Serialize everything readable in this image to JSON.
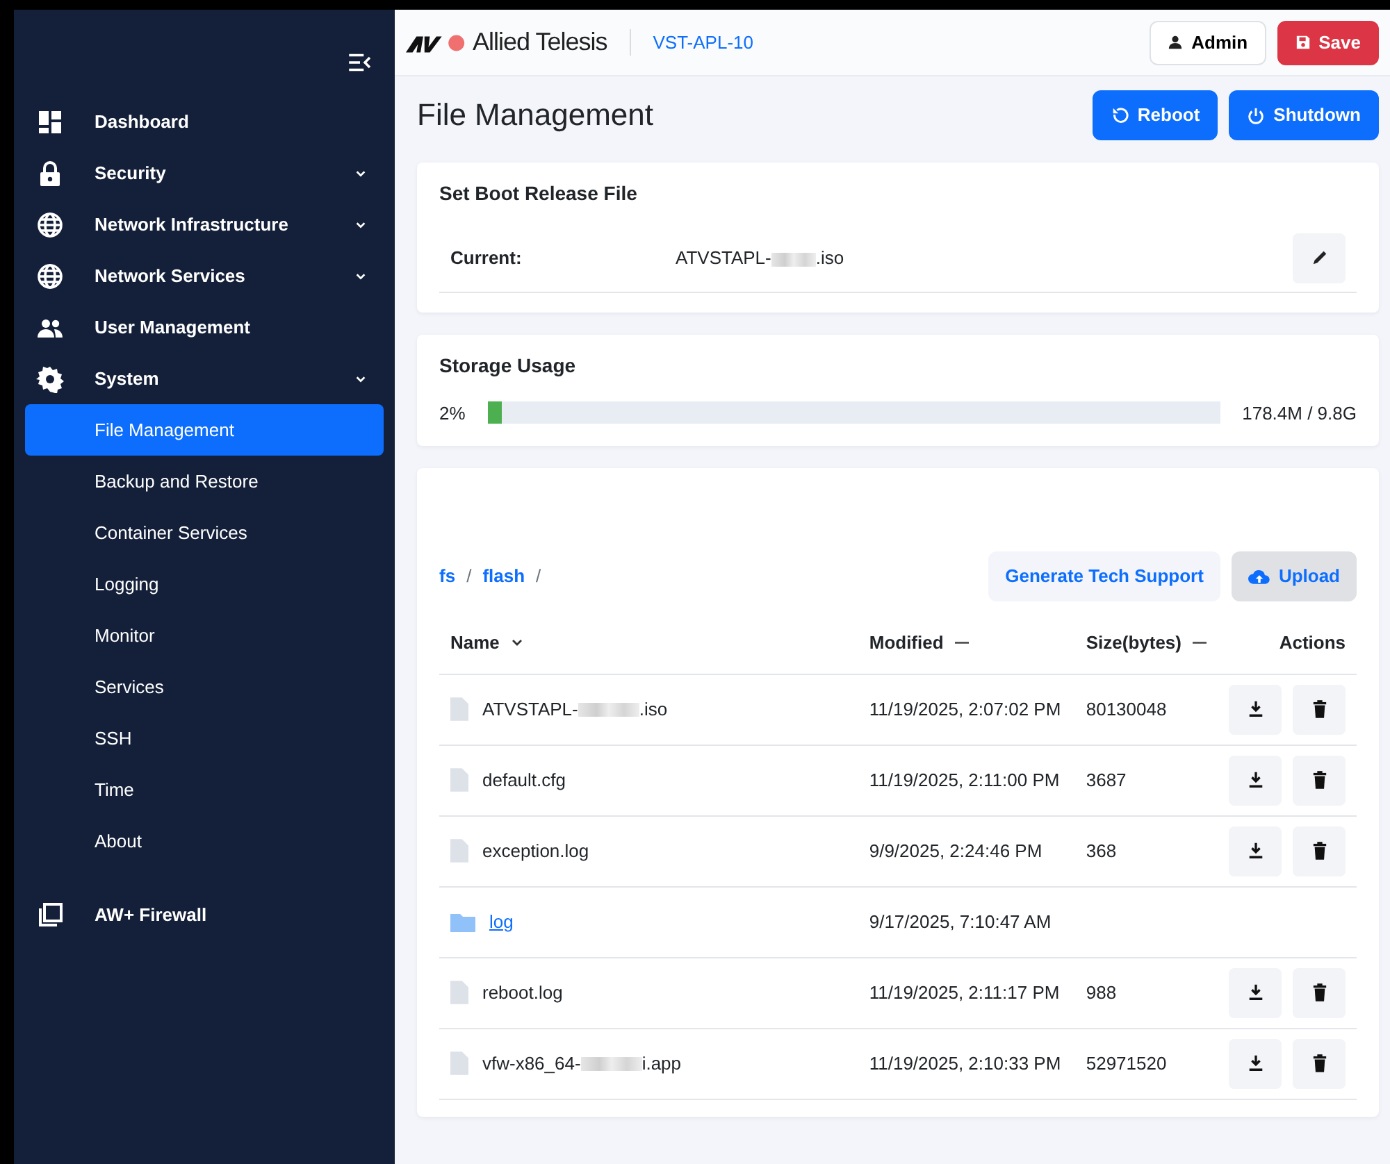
{
  "sidebar": {
    "items": [
      {
        "label": "Dashboard",
        "has_submenu": false,
        "selected": false
      },
      {
        "label": "Security",
        "has_submenu": true,
        "selected": false
      },
      {
        "label": "Network Infrastructure",
        "has_submenu": true,
        "selected": false
      },
      {
        "label": "Network Services",
        "has_submenu": true,
        "selected": false
      },
      {
        "label": "User Management",
        "has_submenu": false,
        "selected": false
      },
      {
        "label": "System",
        "has_submenu": true,
        "expanded": true,
        "selected": false,
        "children": [
          {
            "label": "File Management",
            "selected": true
          },
          {
            "label": "Backup and Restore",
            "selected": false
          },
          {
            "label": "Container Services",
            "selected": false
          },
          {
            "label": "Logging",
            "selected": false
          },
          {
            "label": "Monitor",
            "selected": false
          },
          {
            "label": "Services",
            "selected": false
          },
          {
            "label": "SSH",
            "selected": false
          },
          {
            "label": "Time",
            "selected": false
          },
          {
            "label": "About",
            "selected": false
          }
        ]
      }
    ],
    "footer_item": {
      "label": "AW+ Firewall",
      "selected": false
    }
  },
  "header": {
    "brand": "Allied Telesis",
    "device": "VST-APL-10",
    "user_button": "Admin",
    "save_button": "Save"
  },
  "page": {
    "title": "File Management",
    "buttons": [
      "Reboot",
      "Shutdown"
    ]
  },
  "boot_card": {
    "title": "Set Boot Release File",
    "label": "Current:",
    "value_start": "ATVSTAPL-",
    "redacted": true,
    "value_end": ".iso"
  },
  "storage_card": {
    "title": "Storage Usage",
    "percent": "2%",
    "level": 0.02,
    "reading": "178.4M / 9.8G"
  },
  "files": {
    "breadcrumb": [
      {
        "label": "fs",
        "separator": "/"
      },
      {
        "label": "flash",
        "separator": "/"
      }
    ],
    "buttons": [
      {
        "label": "Generate Tech Support",
        "hovered": false
      },
      {
        "label": "Upload",
        "hovered": true
      }
    ],
    "columns": [
      {
        "label": "Name",
        "sortable": true,
        "sorted": true
      },
      {
        "label": "Modified",
        "sortable": true,
        "sorted": false
      },
      {
        "label": "Size(bytes)",
        "sortable": true,
        "sorted": false
      },
      {
        "label": "Actions",
        "sortable": false
      }
    ],
    "rows": [
      {
        "kind": "file",
        "name_start": "ATVSTAPL-",
        "redacted": true,
        "name_end": ".iso",
        "modified": "11/19/2025, 2:07:02 PM",
        "size": "80130048"
      },
      {
        "kind": "file",
        "name_start": "default.cfg",
        "modified": "11/19/2025, 2:11:00 PM",
        "size": "3687"
      },
      {
        "kind": "file",
        "name_start": "exception.log",
        "modified": "9/9/2025, 2:24:46 PM",
        "size": "368"
      },
      {
        "kind": "folder",
        "name_start": "log",
        "modified": "9/17/2025, 7:10:47 AM"
      },
      {
        "kind": "file",
        "name_start": "reboot.log",
        "modified": "11/19/2025, 2:11:17 PM",
        "size": "988"
      },
      {
        "kind": "file",
        "name_start": "vfw-x86_64-",
        "redacted": true,
        "name_end": "i.app",
        "modified": "11/19/2025, 2:10:33 PM",
        "size": "52971520"
      }
    ]
  }
}
